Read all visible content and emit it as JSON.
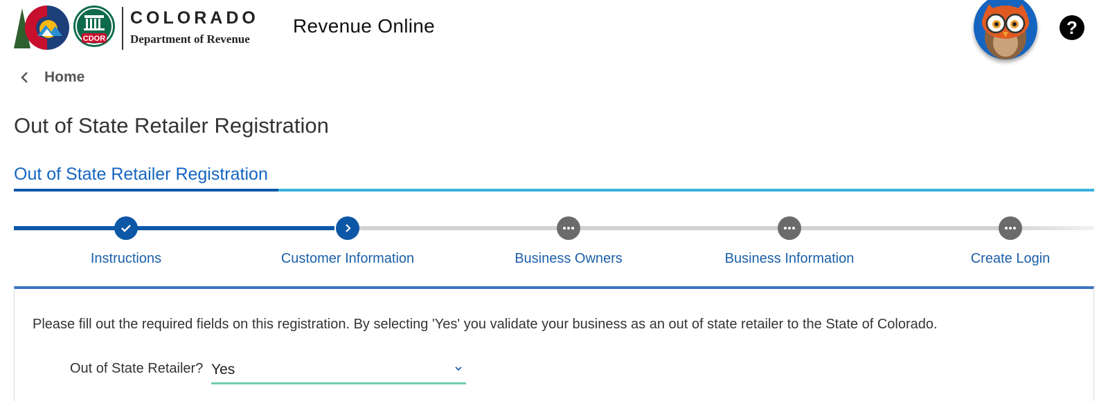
{
  "header": {
    "logo": {
      "state_name": "COLORADO",
      "department": "Department of Revenue",
      "seal_text": "CDOR"
    },
    "app_title": "Revenue Online",
    "help_icon": "question-mark-icon",
    "avatar_icon": "owl-icon"
  },
  "breadcrumb": {
    "icon": "chevron-left-icon",
    "label": "Home"
  },
  "page_title": "Out of State Retailer Registration",
  "section_tab": "Out of State Retailer Registration",
  "stepper": {
    "steps": [
      {
        "label": "Instructions",
        "status": "complete",
        "icon": "check-icon"
      },
      {
        "label": "Customer Information",
        "status": "current",
        "icon": "chevron-right-icon"
      },
      {
        "label": "Business Owners",
        "status": "pending",
        "icon": "more-dots-icon"
      },
      {
        "label": "Business Information",
        "status": "pending",
        "icon": "more-dots-icon"
      },
      {
        "label": "Create Login",
        "status": "pending",
        "icon": "more-dots-icon"
      }
    ]
  },
  "form": {
    "instructions": "Please fill out the required fields on this registration. By selecting 'Yes' you validate your business as an out of state retailer to the State of Colorado.",
    "out_of_state_label": "Out of State Retailer?",
    "out_of_state_value": "Yes",
    "select_icon": "chevron-down-icon"
  },
  "colors": {
    "primary": "#0d57a7",
    "accent": "#39b1dc",
    "link": "#1b5fa8",
    "pending_step": "#6b6b6b",
    "select_underline": "#6fcbb0"
  }
}
